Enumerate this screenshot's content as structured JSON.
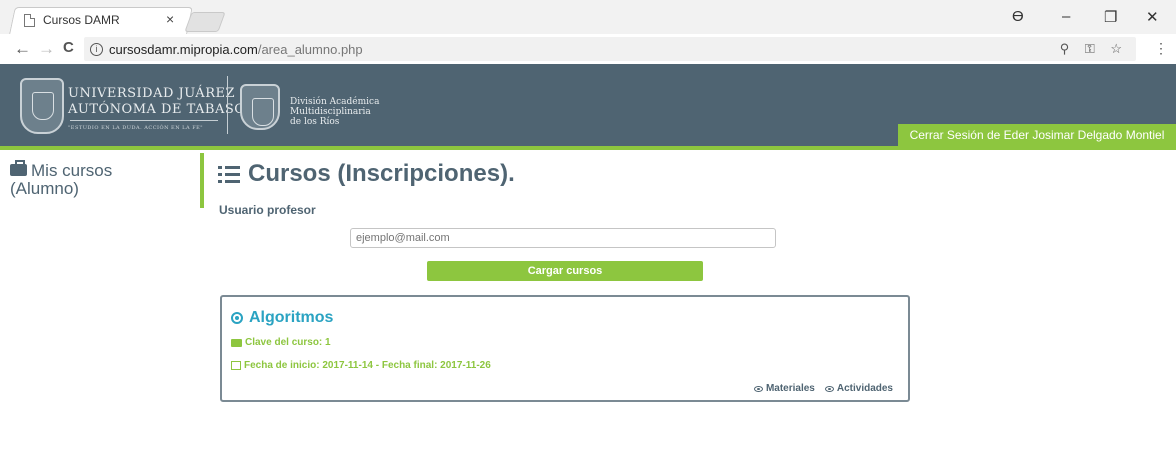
{
  "browser": {
    "tab_title": "Cursos DAMR",
    "tab_close": "×",
    "url_host": "cursosdamr.mipropia.com",
    "url_path": "/area_alumno.php",
    "info": "i",
    "back": "←",
    "forward": "→",
    "reload": "C",
    "omni_icons": "⚲ ⚿ ☆",
    "menu": "⋮",
    "account": "ϴ",
    "minimize": "–",
    "restore": "❐",
    "close": "✕"
  },
  "header": {
    "university_line1": "UNIVERSIDAD JUÁREZ",
    "university_line2": "AUTÓNOMA DE TABASCO",
    "motto": "\"ESTUDIO EN LA DUDA. ACCIÓN EN LA FE\"",
    "division_line1": "División Académica",
    "division_line2": "Multidisciplinaria",
    "division_line3": "de los Ríos",
    "logout": "Cerrar Sesión de Eder Josimar Delgado Montiel"
  },
  "sidebar": {
    "items": [
      {
        "label": "Mis cursos\n(Alumno)"
      }
    ]
  },
  "main": {
    "title": "Cursos (Inscripciones).",
    "user_label": "Usuario profesor",
    "email_placeholder": "ejemplo@mail.com",
    "load_button": "Cargar cursos",
    "course": {
      "name": "Algoritmos",
      "key": "Clave del curso: 1",
      "dates": "Fecha de inicio: 2017-11-14 - Fecha final: 2017-11-26",
      "materials": "Materiales",
      "activities": "Actividades"
    }
  },
  "colors": {
    "header_bg": "#4f6472",
    "accent_green": "#8dc63f",
    "course_title": "#2aa3c2"
  }
}
